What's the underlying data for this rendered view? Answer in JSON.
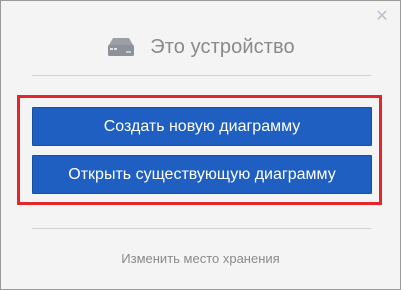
{
  "dialog": {
    "close_icon": "close-icon",
    "header": {
      "icon": "hard-drive-icon",
      "title": "Это устройство"
    },
    "buttons": {
      "create_label": "Создать новую диаграмму",
      "open_label": "Открыть существующую диаграмму"
    },
    "footer": {
      "change_storage_label": "Изменить место хранения"
    }
  },
  "colors": {
    "primary_button": "#1f5fc2",
    "highlight_border": "#e2262c",
    "muted_text": "#8a8a8a",
    "background": "#f4f4f4"
  }
}
